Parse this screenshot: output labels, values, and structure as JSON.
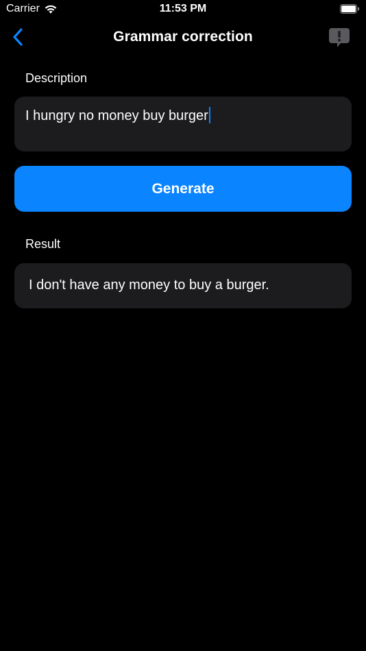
{
  "status_bar": {
    "carrier": "Carrier",
    "time": "11:53 PM",
    "wifi_icon": "wifi-icon",
    "battery_icon": "battery-full-icon"
  },
  "nav": {
    "title": "Grammar correction",
    "back_icon": "chevron-left-icon",
    "report_icon": "exclamation-bubble-icon"
  },
  "description": {
    "label": "Description",
    "value": "I hungry no money buy burger"
  },
  "generate": {
    "label": "Generate"
  },
  "result": {
    "label": "Result",
    "value": "I don't have any money to buy a burger."
  },
  "colors": {
    "background": "#000000",
    "field_background": "#1c1c1e",
    "accent": "#0a84ff",
    "text": "#ffffff",
    "icon_gray": "#5a5a5e"
  }
}
